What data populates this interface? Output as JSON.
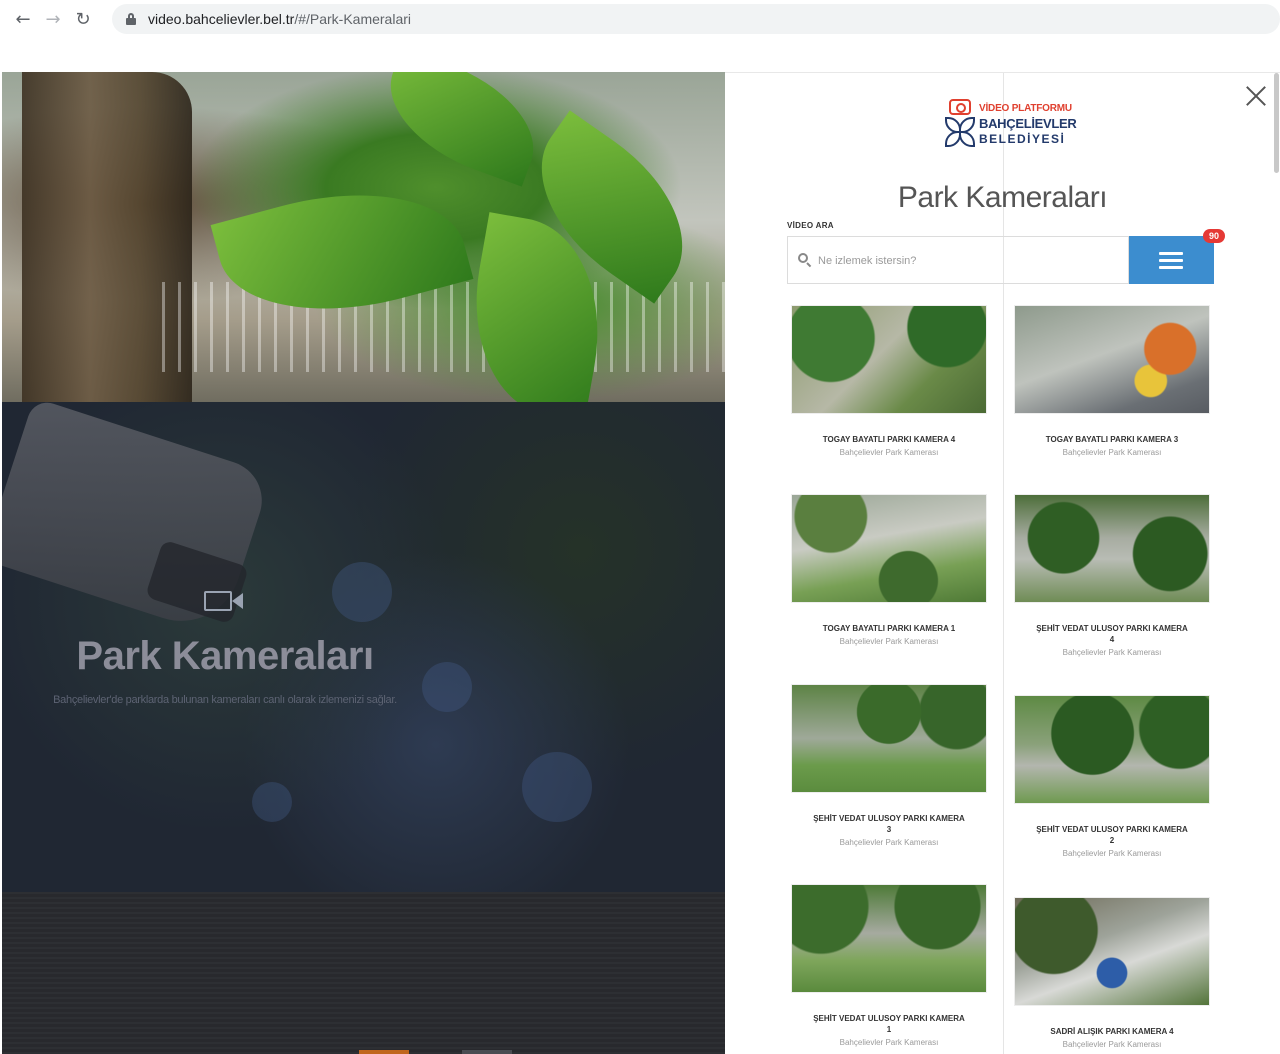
{
  "browser": {
    "back_glyph": "←",
    "forward_glyph": "→",
    "reload_glyph": "↻",
    "url_domain": "video.bahcelievler.bel.tr",
    "url_path": "/#/Park-Kameralari"
  },
  "hero": {
    "title": "Park Kameraları",
    "subtitle": "Bahçelievler'de parklarda bulunan kameraları canlı olarak izlemenizi sağlar."
  },
  "modal": {
    "logo": {
      "line1": "VİDEO PLATFORMU",
      "line2": "BAHÇELİEVLER",
      "line3": "BELEDİYESİ"
    },
    "page_title": "Park Kameraları",
    "search": {
      "label": "VİDEO ARA",
      "placeholder": "Ne izlemek istersin?",
      "value": ""
    },
    "menu_badge": "90",
    "cards": [
      {
        "title": "TOGAY BAYATLI PARKI KAMERA 4",
        "subtitle": "Bahçelievler Park Kamerası"
      },
      {
        "title": "TOGAY BAYATLI PARKI KAMERA 3",
        "subtitle": "Bahçelievler Park Kamerası"
      },
      {
        "title": "TOGAY BAYATLI PARKI KAMERA 1",
        "subtitle": "Bahçelievler Park Kamerası"
      },
      {
        "title": "ŞEHİT VEDAT ULUSOY PARKI KAMERA 4",
        "subtitle": "Bahçelievler Park Kamerası"
      },
      {
        "title": "ŞEHİT VEDAT ULUSOY PARKI KAMERA 3",
        "subtitle": "Bahçelievler Park Kamerası"
      },
      {
        "title": "ŞEHİT VEDAT ULUSOY PARKI KAMERA 2",
        "subtitle": "Bahçelievler Park Kamerası"
      },
      {
        "title": "ŞEHİT VEDAT ULUSOY PARKI KAMERA 1",
        "subtitle": "Bahçelievler Park Kamerası"
      },
      {
        "title": "SADRİ ALIŞIK PARKI KAMERA 4",
        "subtitle": "Bahçelievler Park Kamerası"
      }
    ]
  },
  "colors": {
    "accent_blue": "#3c8dcf",
    "badge_red": "#e53935",
    "logo_red": "#e0402f",
    "logo_navy": "#233a6b"
  }
}
